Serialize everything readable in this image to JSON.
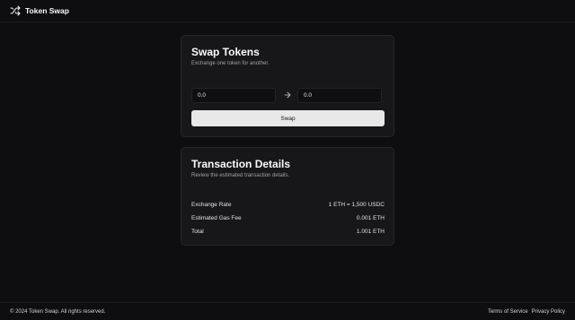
{
  "header": {
    "brand_icon": "shuffle-icon",
    "brand_name": "Token Swap"
  },
  "swap": {
    "title": "Swap Tokens",
    "subtitle": "Exchange one token for another.",
    "from_value": "0.0",
    "arrow_icon": "arrow-right-icon",
    "to_value": "0.0",
    "button_label": "Swap"
  },
  "details": {
    "title": "Transaction Details",
    "subtitle": "Review the estimated transaction details.",
    "rows": [
      {
        "label": "Exchange Rate",
        "value": "1 ETH = 1,500 USDC"
      },
      {
        "label": "Estimated Gas Fee",
        "value": "0.001 ETH"
      },
      {
        "label": "Total",
        "value": "1.001 ETH"
      }
    ]
  },
  "footer": {
    "copyright": "© 2024 Token Swap. All rights reserved.",
    "links": [
      "Terms of Service",
      "Privacy Policy"
    ]
  },
  "colors": {
    "background": "#0e0e10",
    "card": "#17171a",
    "button": "#e8e8e8",
    "muted_text": "#a1a1aa"
  }
}
